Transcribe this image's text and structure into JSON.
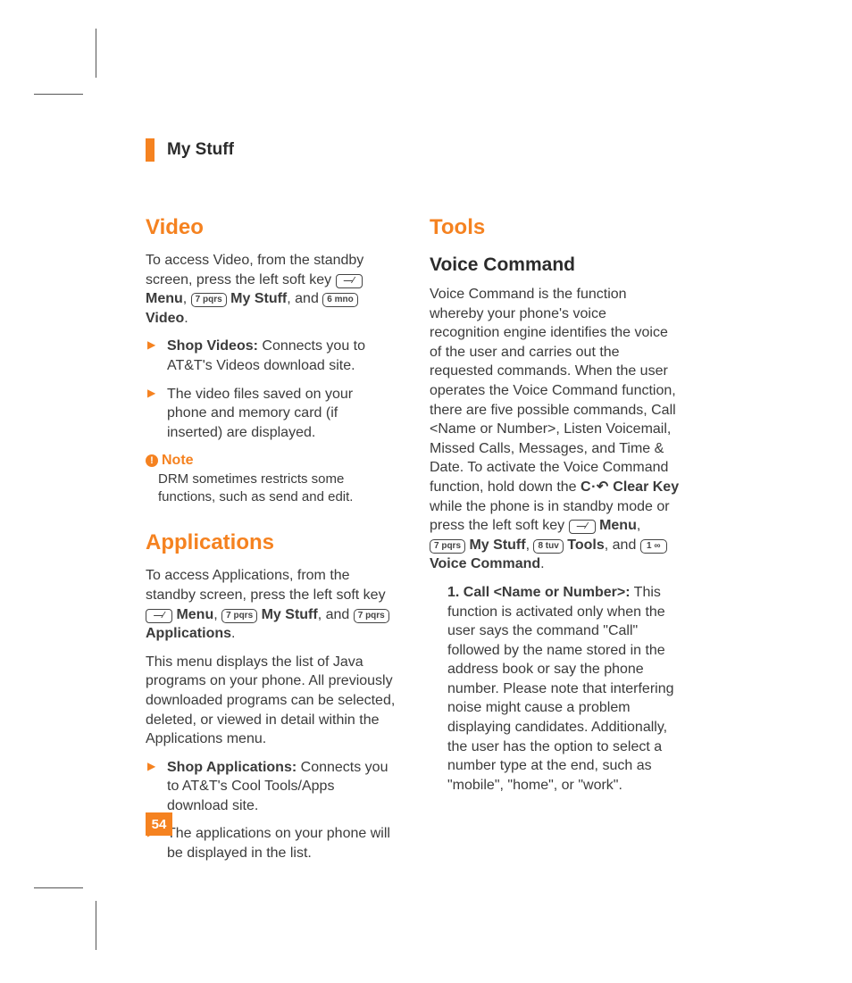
{
  "header": {
    "title": "My Stuff"
  },
  "page_number": "54",
  "left": {
    "video": {
      "heading": "Video",
      "intro_pre": "To access Video, from the standby screen, press the left soft key ",
      "menu": "Menu",
      "my_stuff": "My Stuff",
      "and": ", and ",
      "video_label": "Video",
      "bullets": [
        {
          "lead": "Shop Videos:",
          "rest": " Connects you to AT&T's Videos download site."
        },
        {
          "lead": "",
          "rest": "The video files saved on your phone and memory card (if inserted) are displayed."
        }
      ],
      "note_label": "Note",
      "note_body": "DRM sometimes restricts some functions, such as send and edit."
    },
    "apps": {
      "heading": "Applications",
      "intro_pre": "To access Applications, from the standby screen, press the left soft key ",
      "menu": "Menu",
      "my_stuff": "My Stuff",
      "and": ", and ",
      "apps_label": "Applications",
      "body": "This menu displays the list of Java programs on your phone. All previously downloaded programs can be selected, deleted, or viewed in detail within the Applications menu.",
      "bullets": [
        {
          "lead": "Shop Applications:",
          "rest": " Connects you to AT&T's Cool Tools/Apps download site."
        },
        {
          "lead": "",
          "rest": "The applications on your phone will be displayed in the list."
        }
      ]
    }
  },
  "right": {
    "tools": {
      "heading": "Tools",
      "voice": {
        "subheading": "Voice Command",
        "body_pre": "Voice Command is the function whereby your phone's voice recognition engine identifies the voice of the user and carries out the requested commands. When the user operates the Voice Command function, there are five possible commands, Call <Name or Number>, Listen Voicemail, Missed Calls, Messages, and Time & Date. To activate the Voice Command function, hold down the ",
        "clear_key": "Clear Key",
        "body_mid": " while the phone is in standby mode or press the left soft key ",
        "menu": "Menu",
        "my_stuff": "My Stuff",
        "tools": "Tools",
        "and": ", and ",
        "vc": "Voice Command",
        "item1_lead": "1. Call <Name or Number>:",
        "item1_rest": " This function is activated only when the user says the command \"Call\" followed by the name stored in the address book or say the phone number. Please note that interfering noise might cause a problem displaying candidates. Additionally, the user has the option to select a number type at the end, such as \"mobile\", \"home\", or \"work\"."
      }
    }
  },
  "keys": {
    "softkey": "—⁄",
    "k7": "7 pqrs",
    "k6": "6 mno",
    "k8": "8 tuv",
    "k1": "1 ∞",
    "clear": "C·↶"
  }
}
